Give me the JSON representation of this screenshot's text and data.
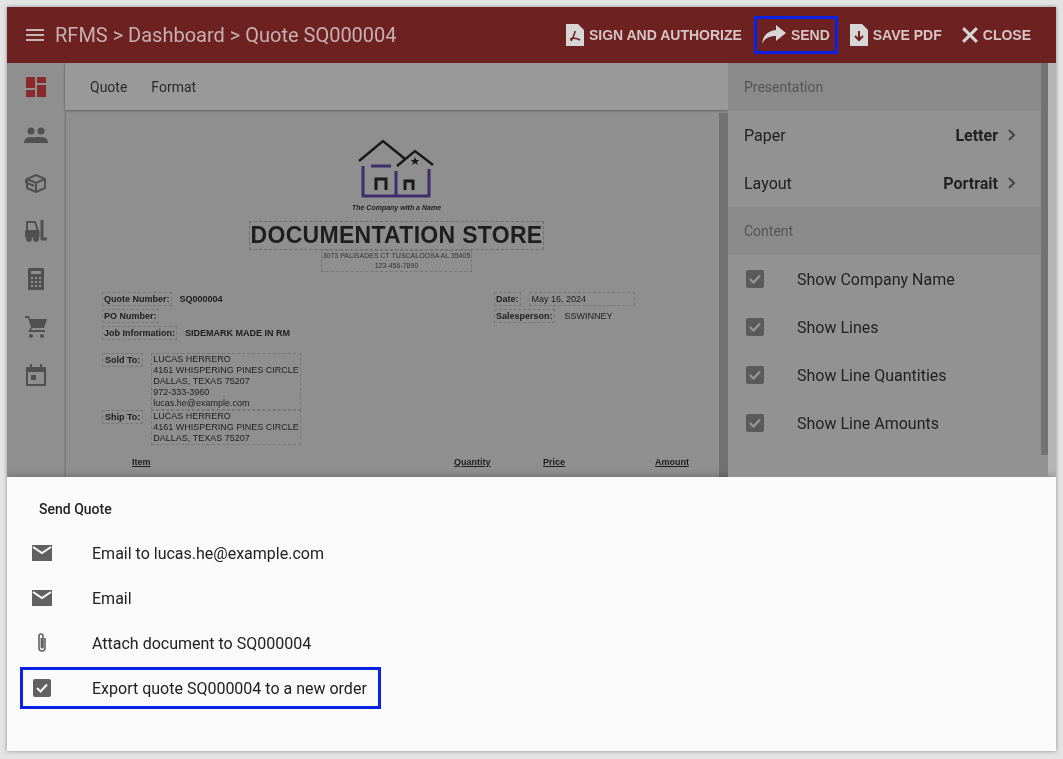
{
  "header": {
    "title": "RFMS > Dashboard > Quote SQ000004",
    "actions": [
      {
        "kind": "pdf",
        "label": "SIGN AND AUTHORIZE",
        "highlighted": false
      },
      {
        "kind": "send",
        "label": "SEND",
        "highlighted": true
      },
      {
        "kind": "save",
        "label": "SAVE PDF",
        "highlighted": false
      },
      {
        "kind": "close",
        "label": "CLOSE",
        "highlighted": false
      }
    ]
  },
  "rail": {
    "items": [
      {
        "kind": "dashboard",
        "selected": true
      },
      {
        "kind": "people",
        "selected": false
      },
      {
        "kind": "box",
        "selected": false
      },
      {
        "kind": "forklift",
        "selected": false
      },
      {
        "kind": "calculator",
        "selected": false
      },
      {
        "kind": "cart",
        "selected": false
      },
      {
        "kind": "calendar",
        "selected": false
      }
    ]
  },
  "tabs": [
    {
      "label": "Quote"
    },
    {
      "label": "Format"
    }
  ],
  "document": {
    "tagline": "The Company with a Name",
    "company": "DOCUMENTATION STORE",
    "address": [
      "3073 PALISADES CT TUSCALOOSA AL 35405",
      "123-456-7890"
    ],
    "left_fields": [
      {
        "label": "Quote Number:",
        "value": "SQ000004"
      },
      {
        "label": "PO Number:"
      },
      {
        "label": "Job Information:",
        "value": "SIDEMARK MADE IN RM"
      }
    ],
    "right_fields": [
      {
        "label": "Date:",
        "value": "May 16, 2024"
      },
      {
        "label": "Salesperson:",
        "value": "SSWINNEY"
      }
    ],
    "parties": [
      {
        "label": "Sold To:",
        "lines": [
          "LUCAS HERRERO",
          "4161 WHISPERING PINES CIRCLE",
          "DALLAS, TEXAS 75207",
          "972-333-3960",
          "lucas.he@example.com"
        ]
      },
      {
        "label": "Ship To:",
        "lines": [
          "LUCAS HERRERO",
          "4161 WHISPERING PINES CIRCLE",
          "DALLAS, TEXAS 75207"
        ]
      }
    ],
    "columns": [
      "Item",
      "Quantity",
      "Price",
      "Amount"
    ]
  },
  "panel": {
    "sections": [
      {
        "title": "Presentation",
        "rows": [
          {
            "kind": "option",
            "label": "Paper",
            "value": "Letter"
          },
          {
            "kind": "option",
            "label": "Layout",
            "value": "Portrait"
          }
        ]
      },
      {
        "title": "Content",
        "rows": [
          {
            "kind": "check",
            "label": "Show Company Name",
            "checked": true
          },
          {
            "kind": "check",
            "label": "Show Lines",
            "checked": true
          },
          {
            "kind": "check",
            "label": "Show Line Quantities",
            "checked": true
          },
          {
            "kind": "check",
            "label": "Show Line Amounts",
            "checked": true
          }
        ]
      }
    ]
  },
  "sheet": {
    "title": "Send Quote",
    "items": [
      {
        "kind": "mail",
        "label": "Email to lucas.he@example.com",
        "highlighted": false
      },
      {
        "kind": "mail",
        "label": "Email",
        "highlighted": false
      },
      {
        "kind": "attach",
        "label": "Attach document to SQ000004",
        "highlighted": false
      },
      {
        "kind": "check",
        "label": "Export quote SQ000004 to a new order",
        "highlighted": true
      }
    ]
  }
}
